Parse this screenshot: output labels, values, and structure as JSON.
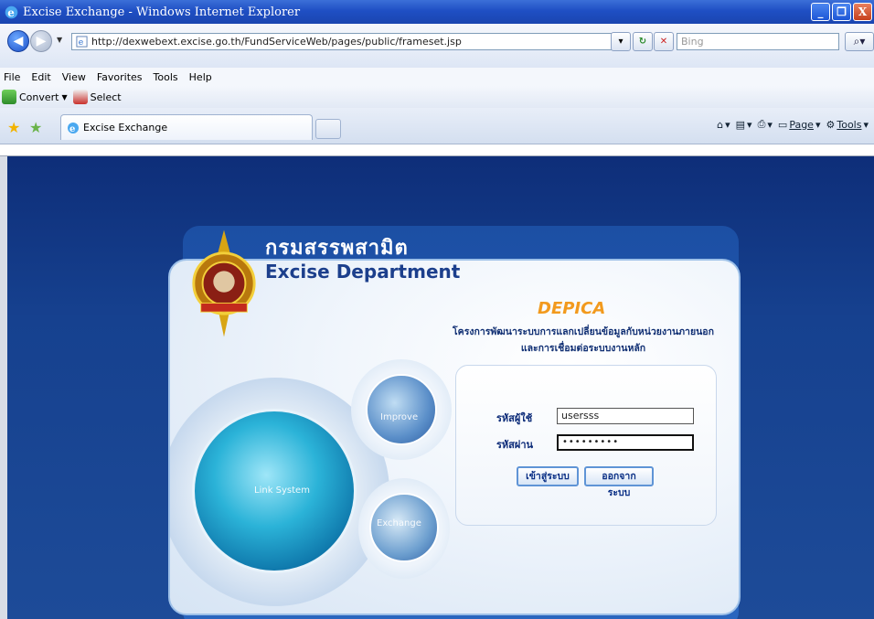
{
  "window": {
    "title": "Excise Exchange - Windows Internet Explorer",
    "buttons": [
      "_",
      "❐",
      "X"
    ]
  },
  "address_bar": {
    "url": "http://dexwebext.excise.go.th/FundServiceWeb/pages/public/frameset.jsp",
    "search_placeholder": "Bing"
  },
  "menu": {
    "items": [
      "File",
      "Edit",
      "View",
      "Favorites",
      "Tools",
      "Help"
    ]
  },
  "command_bar": {
    "convert_label": "Convert",
    "select_label": "Select"
  },
  "tabs": {
    "active_label": "Excise Exchange"
  },
  "toolbar_right": {
    "page_label": "Page",
    "tools_label": "Tools"
  },
  "page": {
    "department_thai": "กรมสรรพสามิต",
    "department_en": "Excise Department",
    "app_name": "DEPICA",
    "project_line1": "โครงการพัฒนาระบบการแลกเปลี่ยนข้อมูลกับหน่วยงานภายนอก",
    "project_line2": "และการเชื่อมต่อระบบงานหลัก",
    "username_label": "รหัสผู้ใช้",
    "username_value": "usersss",
    "password_label": "รหัสผ่าน",
    "password_value": "•••••••••",
    "login_button": "เข้าสู่ระบบ",
    "logout_button": "ออกจากระบบ",
    "deco_improve": "Improve",
    "deco_link": "Link System",
    "deco_exchange": "Exchange"
  },
  "colors": {
    "title_bar": "#1f4fc4",
    "page_background": "#16418f",
    "app_name_orange": "#f29a1d",
    "label_blue": "#0b2a78"
  }
}
